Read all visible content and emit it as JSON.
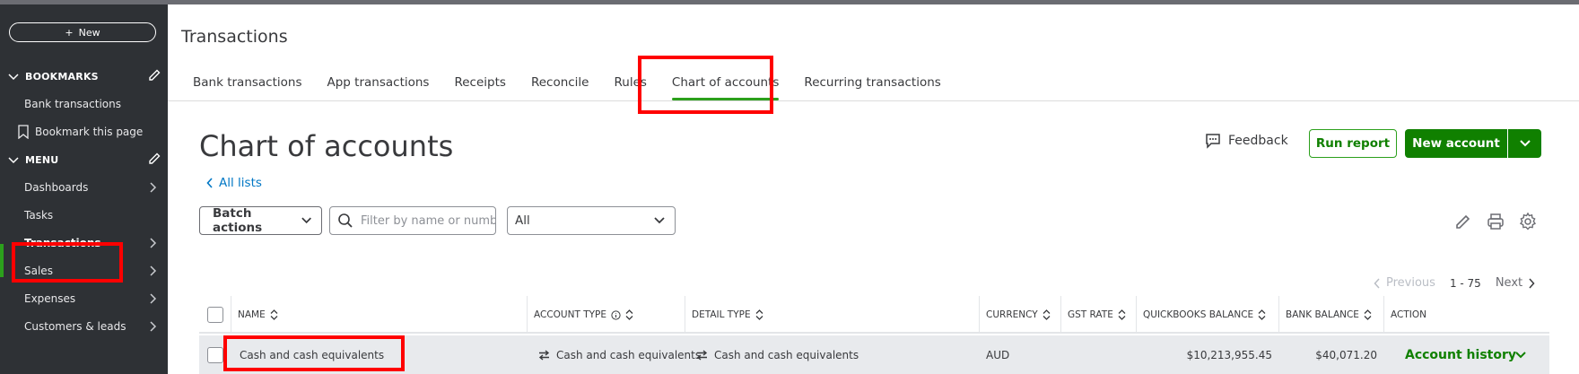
{
  "sidebar": {
    "new_label": "New",
    "bookmarks_heading": "BOOKMARKS",
    "bookmarks": [
      {
        "label": "Bank transactions"
      },
      {
        "label": "Bookmark this page"
      }
    ],
    "menu_heading": "MENU",
    "menu": [
      {
        "label": "Dashboards"
      },
      {
        "label": "Tasks"
      },
      {
        "label": "Transactions"
      },
      {
        "label": "Sales"
      },
      {
        "label": "Expenses"
      },
      {
        "label": "Customers & leads"
      }
    ],
    "accent_color": "#2ca01c"
  },
  "header": {
    "title": "Transactions",
    "tabs": [
      {
        "label": "Bank transactions"
      },
      {
        "label": "App transactions"
      },
      {
        "label": "Receipts"
      },
      {
        "label": "Reconcile"
      },
      {
        "label": "Rules"
      },
      {
        "label": "Chart of accounts"
      },
      {
        "label": "Recurring transactions"
      }
    ],
    "active_tab": "Chart of accounts"
  },
  "main": {
    "title": "Chart of accounts",
    "back_link": "All lists",
    "feedback_label": "Feedback",
    "run_report_label": "Run report",
    "new_account_label": "New account",
    "batch_actions_label": "Batch actions",
    "filter_placeholder": "Filter by name or number",
    "type_filter_value": "All",
    "pager": {
      "previous_label": "Previous",
      "range": "1 - 75",
      "next_label": "Next"
    },
    "table": {
      "columns": [
        "NAME",
        "ACCOUNT TYPE",
        "DETAIL TYPE",
        "CURRENCY",
        "GST RATE",
        "QUICKBOOKS BALANCE",
        "BANK BALANCE",
        "ACTION"
      ],
      "rows": [
        {
          "name": "Cash and cash equivalents",
          "account_type": "Cash and cash equivalents",
          "detail_type": "Cash and cash equivalents",
          "currency": "AUD",
          "gst_rate": "",
          "quickbooks_balance": "$10,213,955.45",
          "bank_balance": "$40,071.20",
          "action": "Account history"
        }
      ]
    }
  },
  "colors": {
    "primary_green": "#108000",
    "link_blue": "#0077c5",
    "highlight_red": "#ff0000"
  }
}
